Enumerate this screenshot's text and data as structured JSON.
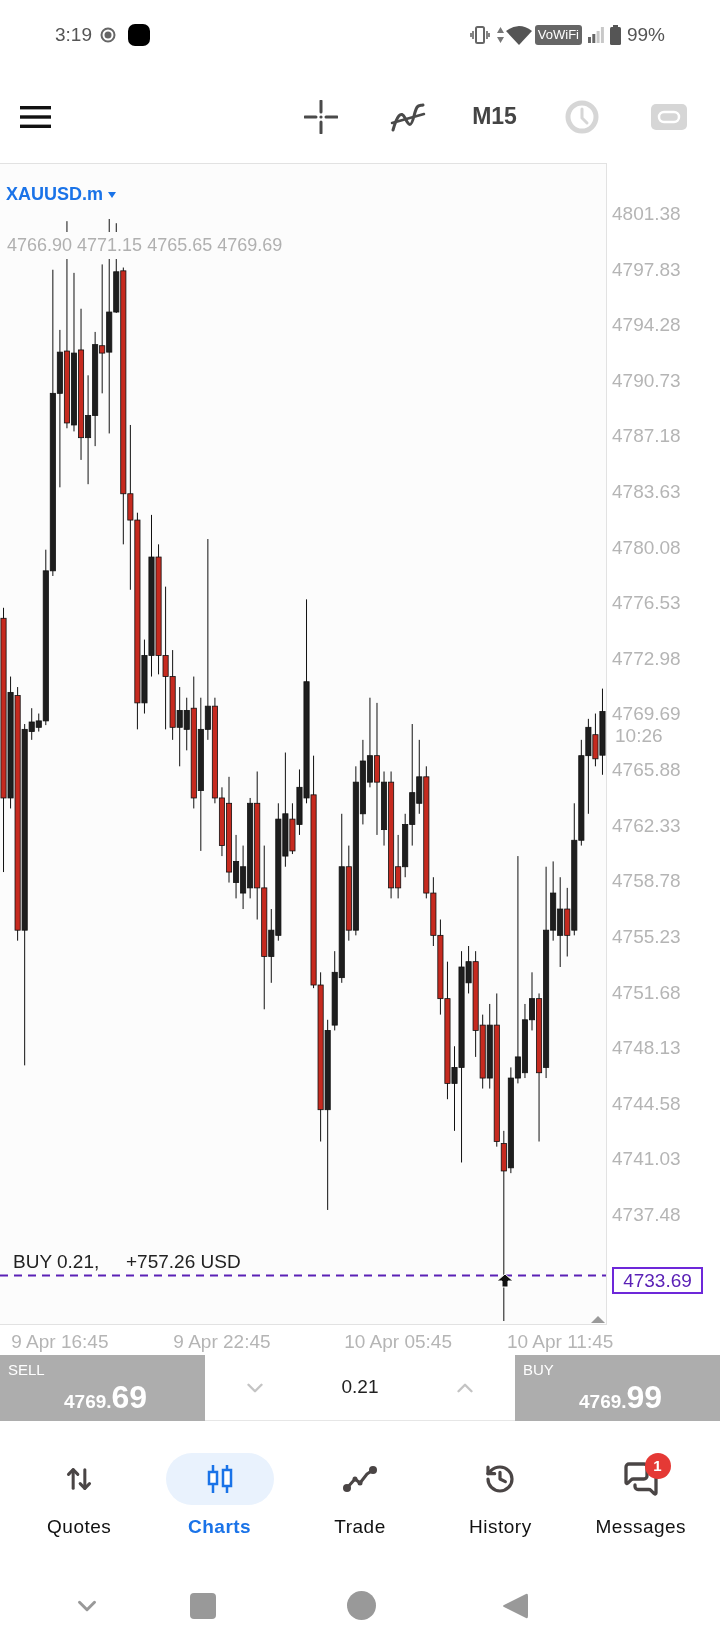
{
  "status_bar": {
    "time": "3:19",
    "network_badge": "VoWiFi",
    "battery": "99%"
  },
  "toolbar": {
    "timeframe": "M15",
    "buttons": [
      {
        "disabled": false
      },
      {
        "disabled": false
      },
      {
        "disabled": true
      },
      {
        "disabled": true
      }
    ]
  },
  "chart": {
    "symbol": "XAUUSD.m",
    "ohlc_text": "4766.90 4771.15 4765.65 4769.69",
    "current_price": "4769.69",
    "current_time": "10:26",
    "position": {
      "label": "BUY 0.21,",
      "profit": "+757.26 USD",
      "price": "4733.69"
    },
    "chart_data": {
      "type": "candlestick",
      "categories": [
        null,
        null,
        null,
        null,
        null,
        null,
        null,
        null,
        "9 Apr 16:45",
        null,
        null,
        null,
        null,
        null,
        null,
        null,
        null,
        null,
        null,
        null,
        null,
        null,
        null,
        null,
        null,
        null,
        null,
        null,
        null,
        null,
        null,
        "9 Apr 22:45",
        null,
        null,
        null,
        null,
        null,
        null,
        null,
        null,
        null,
        null,
        null,
        null,
        null,
        null,
        null,
        null,
        null,
        null,
        null,
        null,
        null,
        null,
        null,
        null,
        "10 Apr 05:45",
        null,
        null,
        null,
        null,
        null,
        null,
        null,
        null,
        null,
        null,
        null,
        null,
        null,
        null,
        null,
        null,
        null,
        null,
        null,
        null,
        null,
        null,
        "10 Apr 11:45",
        null,
        null,
        null,
        null,
        null,
        null
      ],
      "ohlc": [
        [
          4775.64,
          4776.31,
          4759.44,
          4764.17
        ],
        [
          4764.17,
          4771.92,
          4763.5,
          4770.91
        ],
        [
          4770.71,
          4771.25,
          4755.06,
          4755.73
        ],
        [
          4755.73,
          4768.89,
          4747.1,
          4768.55
        ],
        [
          4768.41,
          4769.9,
          4767.88,
          4769.02
        ],
        [
          4768.68,
          4769.56,
          4768.41,
          4769.09
        ],
        [
          4769.09,
          4780.02,
          4768.82,
          4778.67
        ],
        [
          4778.67,
          4797.89,
          4778.34,
          4790.0
        ],
        [
          4790.0,
          4794.05,
          4784.0,
          4792.63
        ],
        [
          4792.7,
          4800.99,
          4787.77,
          4788.11
        ],
        [
          4787.98,
          4797.69,
          4787.57,
          4792.57
        ],
        [
          4792.77,
          4795.4,
          4785.75,
          4787.17
        ],
        [
          4787.17,
          4791.15,
          4784.2,
          4788.59
        ],
        [
          4788.59,
          4793.92,
          4786.63,
          4793.11
        ],
        [
          4793.04,
          4798.23,
          4790.0,
          4792.57
        ],
        [
          4792.63,
          4801.13,
          4787.44,
          4795.19
        ],
        [
          4795.19,
          4800.86,
          4795.13,
          4797.76
        ],
        [
          4797.82,
          4798.03,
          4780.36,
          4783.59
        ],
        [
          4783.59,
          4787.98,
          4777.46,
          4781.91
        ],
        [
          4781.91,
          4782.38,
          4768.55,
          4770.24
        ],
        [
          4770.24,
          4774.28,
          4769.56,
          4773.27
        ],
        [
          4773.27,
          4782.24,
          4771.92,
          4779.55
        ],
        [
          4779.55,
          4780.36,
          4772.06,
          4773.27
        ],
        [
          4773.27,
          4777.66,
          4768.55,
          4771.92
        ],
        [
          4771.92,
          4773.61,
          4767.88,
          4768.68
        ],
        [
          4768.68,
          4771.25,
          4766.19,
          4769.76
        ],
        [
          4768.55,
          4770.57,
          4767.21,
          4769.76
        ],
        [
          4769.9,
          4771.92,
          4763.5,
          4764.17
        ],
        [
          4764.64,
          4770.57,
          4760.79,
          4768.55
        ],
        [
          4768.55,
          4780.7,
          4767.88,
          4770.03
        ],
        [
          4770.03,
          4770.57,
          4763.83,
          4764.17
        ],
        [
          4764.17,
          4764.85,
          4760.46,
          4761.13
        ],
        [
          4763.83,
          4765.52,
          4758.77,
          4759.44
        ],
        [
          4758.77,
          4761.81,
          4757.76,
          4760.12
        ],
        [
          4758.1,
          4761.13,
          4757.08,
          4759.78
        ],
        [
          4758.43,
          4764.17,
          4757.76,
          4763.83
        ],
        [
          4763.83,
          4765.86,
          4756.41,
          4758.43
        ],
        [
          4758.43,
          4761.13,
          4750.68,
          4754.05
        ],
        [
          4754.05,
          4757.08,
          4752.37,
          4755.73
        ],
        [
          4755.4,
          4763.83,
          4755.06,
          4762.82
        ],
        [
          4760.46,
          4767.07,
          4759.78,
          4763.16
        ],
        [
          4762.82,
          4763.83,
          4760.59,
          4760.79
        ],
        [
          4762.48,
          4765.99,
          4761.81,
          4764.85
        ],
        [
          4764.17,
          4776.85,
          4763.83,
          4771.59
        ],
        [
          4764.37,
          4766.87,
          4752.03,
          4752.23
        ],
        [
          4752.23,
          4753.04,
          4742.24,
          4744.27
        ],
        [
          4744.27,
          4750.01,
          4737.87,
          4749.33
        ],
        [
          4749.67,
          4754.39,
          4749.33,
          4753.04
        ],
        [
          4752.7,
          4763.16,
          4752.37,
          4759.78
        ],
        [
          4759.78,
          4761.13,
          4755.06,
          4755.73
        ],
        [
          4755.73,
          4766.19,
          4755.4,
          4765.18
        ],
        [
          4763.16,
          4767.88,
          4762.48,
          4766.53
        ],
        [
          4765.18,
          4770.57,
          4764.85,
          4766.87
        ],
        [
          4766.87,
          4770.24,
          4761.81,
          4765.18
        ],
        [
          4762.15,
          4765.86,
          4761.13,
          4765.18
        ],
        [
          4765.18,
          4765.86,
          4757.76,
          4758.43
        ],
        [
          4759.78,
          4761.81,
          4757.76,
          4758.43
        ],
        [
          4759.78,
          4763.16,
          4759.11,
          4762.48
        ],
        [
          4762.48,
          4768.89,
          4761.13,
          4764.51
        ],
        [
          4763.83,
          4767.88,
          4763.16,
          4765.52
        ],
        [
          4765.52,
          4766.19,
          4757.76,
          4758.1
        ],
        [
          4758.1,
          4759.11,
          4754.72,
          4755.4
        ],
        [
          4755.4,
          4756.41,
          4750.34,
          4751.36
        ],
        [
          4751.36,
          4753.72,
          4744.94,
          4745.95
        ],
        [
          4745.95,
          4748.32,
          4742.92,
          4746.97
        ],
        [
          4746.97,
          4754.39,
          4740.9,
          4753.38
        ],
        [
          4752.37,
          4754.72,
          4751.69,
          4753.72
        ],
        [
          4753.72,
          4754.39,
          4747.64,
          4749.33
        ],
        [
          4749.67,
          4750.34,
          4745.62,
          4746.29
        ],
        [
          4746.29,
          4751.02,
          4745.62,
          4749.67
        ],
        [
          4749.67,
          4751.69,
          4741.91,
          4742.24
        ],
        [
          4742.11,
          4742.92,
          4730.78,
          4740.36
        ],
        [
          4740.56,
          4746.97,
          4740.22,
          4746.29
        ],
        [
          4746.29,
          4760.46,
          4745.95,
          4747.64
        ],
        [
          4746.63,
          4751.02,
          4746.29,
          4750.01
        ],
        [
          4750.01,
          4753.04,
          4749.33,
          4751.36
        ],
        [
          4751.36,
          4751.69,
          4742.24,
          4746.63
        ],
        [
          4746.97,
          4759.78,
          4746.29,
          4755.73
        ],
        [
          4755.73,
          4760.12,
          4755.06,
          4758.1
        ],
        [
          4755.4,
          4759.11,
          4753.38,
          4757.08
        ],
        [
          4757.08,
          4758.43,
          4754.05,
          4755.4
        ],
        [
          4755.73,
          4763.83,
          4755.4,
          4761.47
        ],
        [
          4761.47,
          4767.88,
          4761.13,
          4766.87
        ],
        [
          4766.87,
          4769.22,
          4763.16,
          4768.68
        ],
        [
          4768.21,
          4769.56,
          4766.19,
          4766.67
        ],
        [
          4766.9,
          4771.15,
          4765.65,
          4769.69
        ]
      ],
      "ylim": [
        4730.59,
        4804.64
      ],
      "yticks": [
        {
          "value": 4801.38,
          "label": "4801.38"
        },
        {
          "value": 4797.83,
          "label": "4797.83"
        },
        {
          "value": 4794.28,
          "label": "4794.28"
        },
        {
          "value": 4790.73,
          "label": "4790.73"
        },
        {
          "value": 4787.18,
          "label": "4787.18"
        },
        {
          "value": 4783.63,
          "label": "4783.63"
        },
        {
          "value": 4780.08,
          "label": "4780.08"
        },
        {
          "value": 4776.53,
          "label": "4776.53"
        },
        {
          "value": 4772.98,
          "label": "4772.98"
        },
        {
          "value": 4765.88,
          "label": "4765.88"
        },
        {
          "value": 4762.33,
          "label": "4762.33"
        },
        {
          "value": 4758.78,
          "label": "4758.78"
        },
        {
          "value": 4755.23,
          "label": "4755.23"
        },
        {
          "value": 4751.68,
          "label": "4751.68"
        },
        {
          "value": 4748.13,
          "label": "4748.13"
        },
        {
          "value": 4744.58,
          "label": "4744.58"
        },
        {
          "value": 4741.03,
          "label": "4741.03"
        },
        {
          "value": 4737.48,
          "label": "4737.48"
        }
      ],
      "ref_lines": [
        {
          "axis": "y",
          "value": 4733.69,
          "color": "#5b21b6"
        }
      ]
    }
  },
  "order_panel": {
    "sell": {
      "label": "SELL",
      "price": "4769.",
      "pips": "69"
    },
    "volume": "0.21",
    "buy": {
      "label": "BUY",
      "price": "4769.",
      "pips": "99"
    }
  },
  "nav": [
    {
      "label": "Quotes",
      "selected": false
    },
    {
      "label": "Charts",
      "selected": true
    },
    {
      "label": "Trade",
      "selected": false
    },
    {
      "label": "History",
      "selected": false
    },
    {
      "label": "Messages",
      "selected": false,
      "badge": "1"
    }
  ]
}
